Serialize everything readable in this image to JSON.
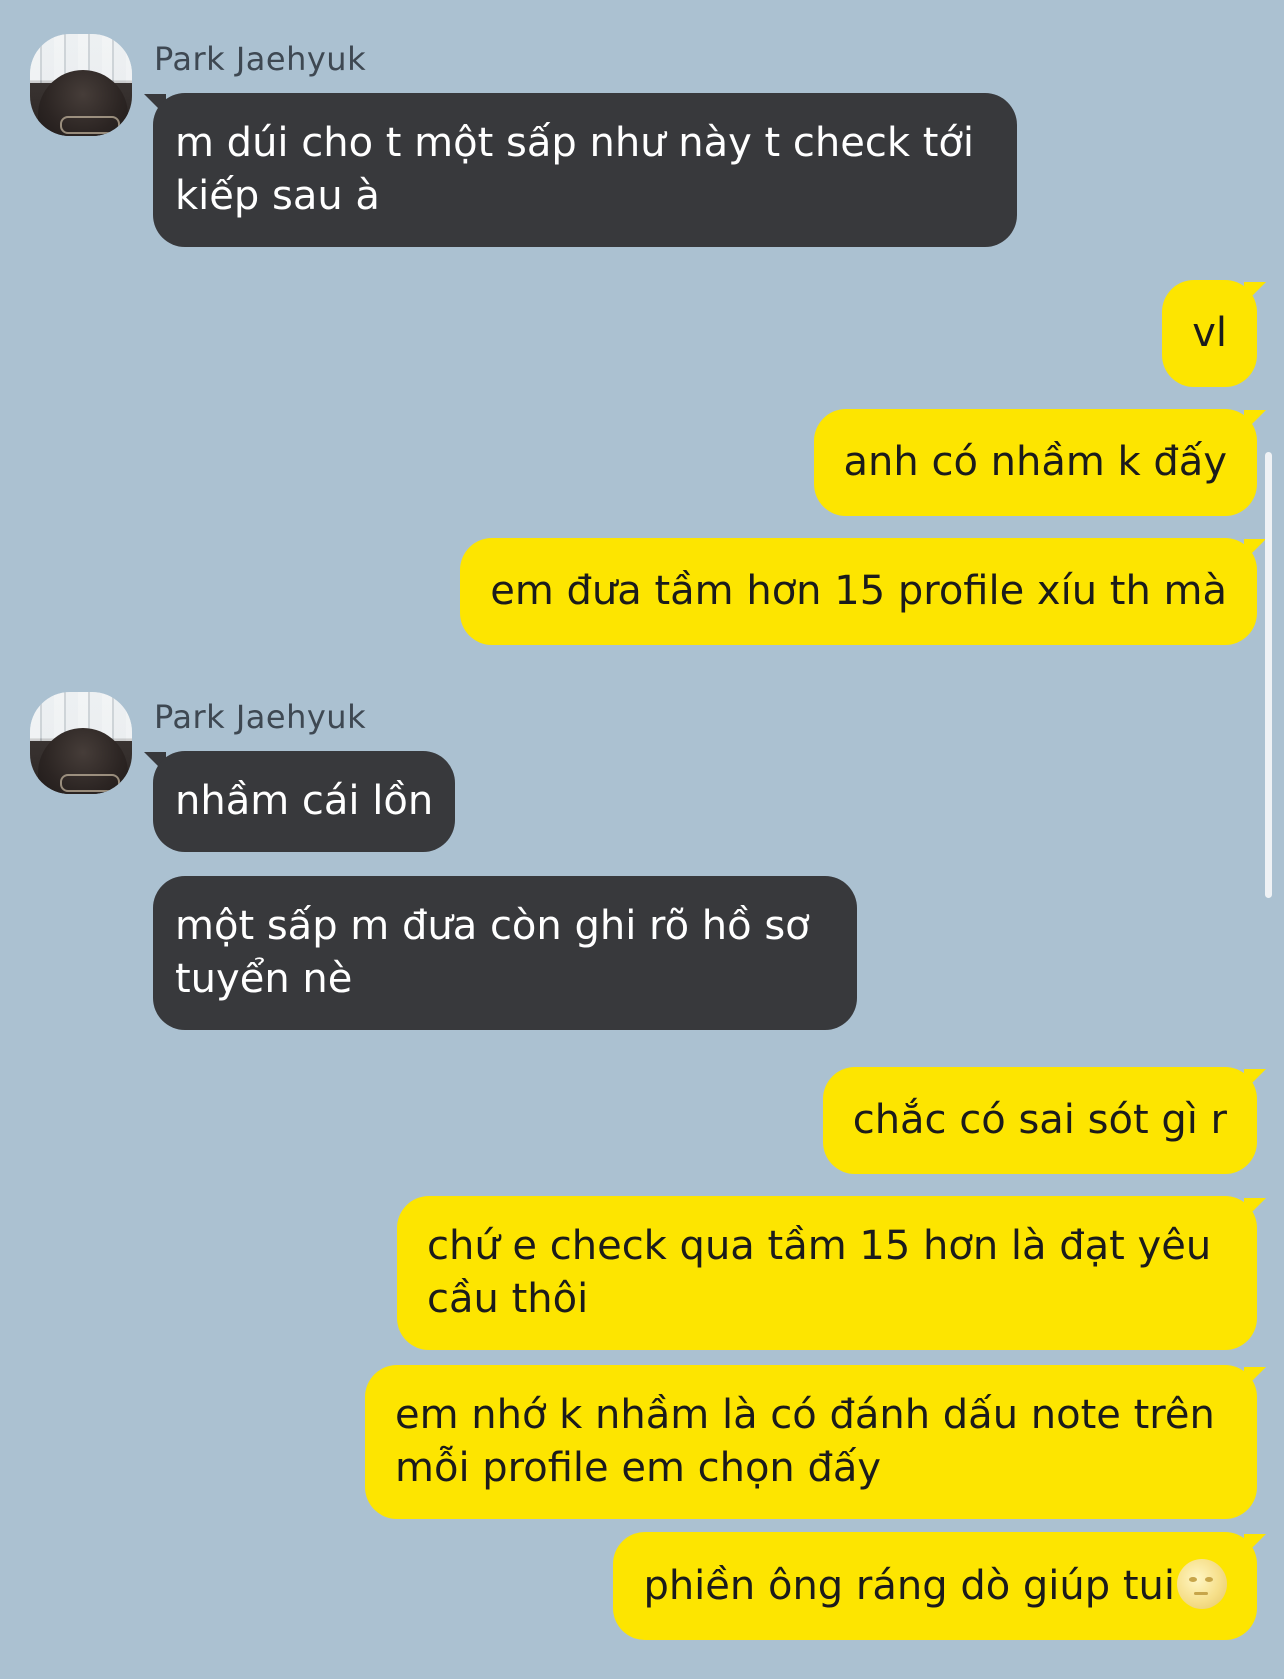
{
  "conversation": {
    "contact_name": "Park Jaehyuk",
    "groups": [
      {
        "sender": "Park Jaehyuk",
        "messages": [
          "m dúi cho t một sấp như này t check tới kiếp sau à"
        ]
      },
      {
        "sender": "me",
        "messages": [
          "vl",
          "anh có nhầm k đấy",
          "em đưa tầm hơn 15 profile xíu th mà"
        ]
      },
      {
        "sender": "Park Jaehyuk",
        "messages": [
          "nhầm cái lồn",
          "một sấp m đưa còn ghi rõ hồ sơ tuyển nè"
        ]
      },
      {
        "sender": "me",
        "messages": [
          "chắc có sai sót gì r",
          "chứ e check qua tầm 15 hơn là đạt yêu cầu thôi",
          "em nhớ k nhầm là có đánh dấu note trên mỗi profile em chọn đấy",
          "phiền ông ráng dò giúp tui"
        ]
      }
    ],
    "last_message_emoji": "full-moon-face-icon"
  },
  "colors": {
    "background": "#abc1d1",
    "incoming_bubble": "#38393c",
    "outgoing_bubble": "#fde500",
    "sender_name": "#3e4852"
  }
}
